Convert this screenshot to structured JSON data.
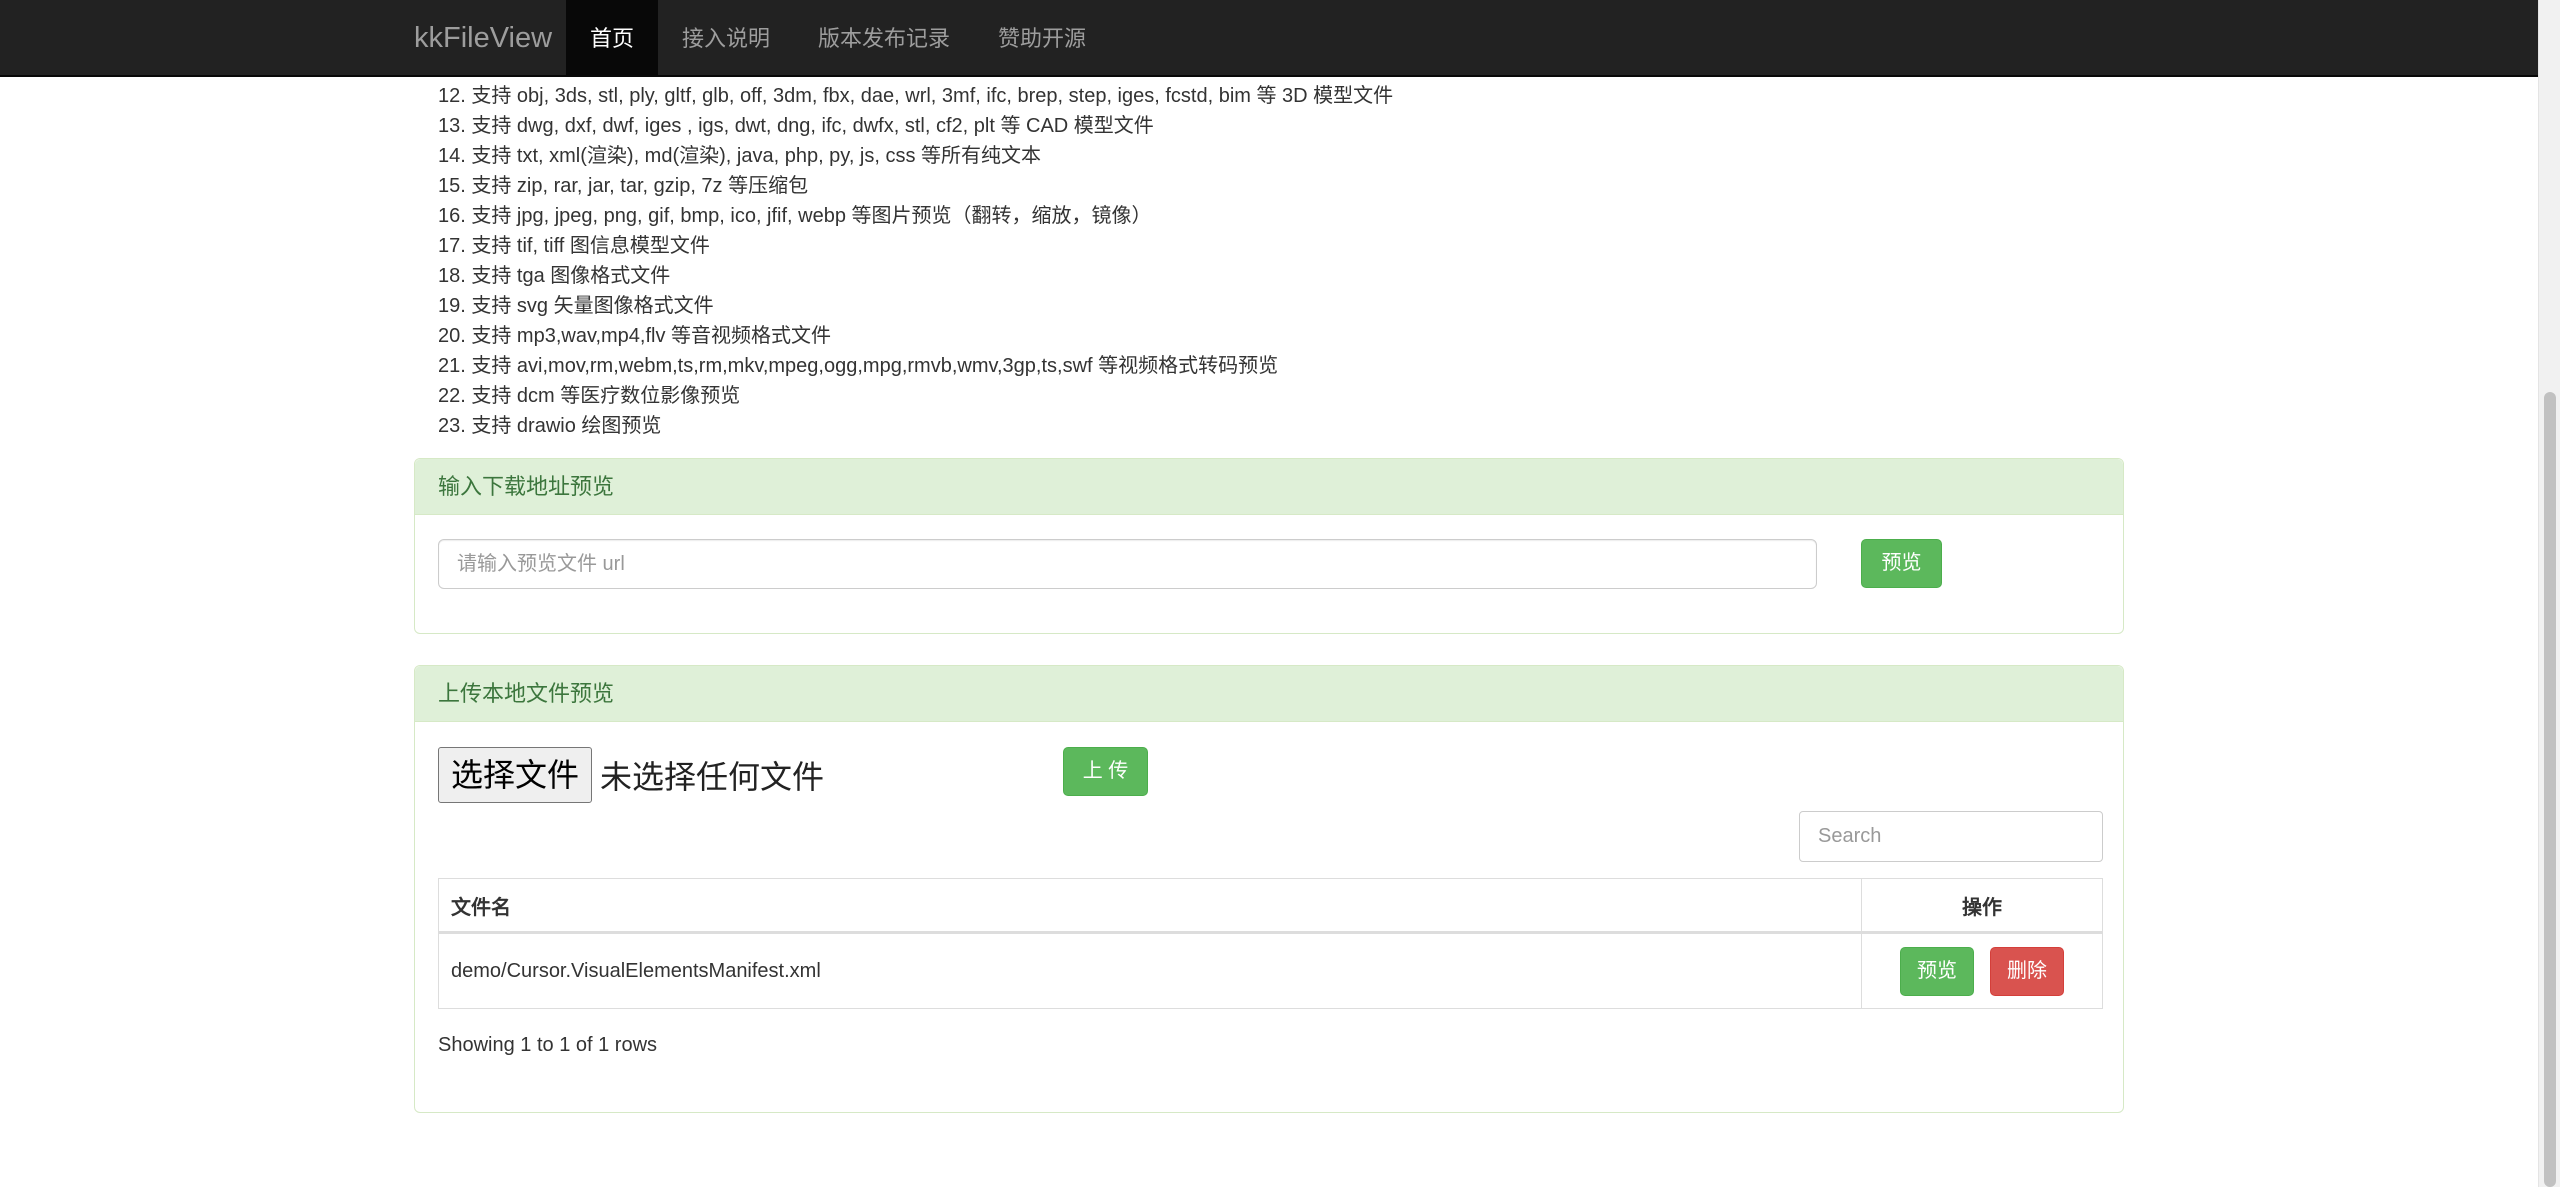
{
  "navbar": {
    "brand": "kkFileView",
    "items": [
      {
        "label": "首页",
        "active": true
      },
      {
        "label": "接入说明",
        "active": false
      },
      {
        "label": "版本发布记录",
        "active": false
      },
      {
        "label": "赞助开源",
        "active": false
      }
    ]
  },
  "features": [
    "12. 支持 obj, 3ds, stl, ply, gltf, glb, off, 3dm, fbx, dae, wrl, 3mf, ifc, brep, step, iges, fcstd, bim 等 3D 模型文件",
    "13. 支持 dwg, dxf, dwf, iges , igs, dwt, dng, ifc, dwfx, stl, cf2, plt 等 CAD 模型文件",
    "14. 支持 txt, xml(渲染), md(渲染), java, php, py, js, css 等所有纯文本",
    "15. 支持 zip, rar, jar, tar, gzip, 7z 等压缩包",
    "16. 支持 jpg, jpeg, png, gif, bmp, ico, jfif, webp 等图片预览（翻转，缩放，镜像）",
    "17. 支持 tif, tiff 图信息模型文件",
    "18. 支持 tga 图像格式文件",
    "19. 支持 svg 矢量图像格式文件",
    "20. 支持 mp3,wav,mp4,flv 等音视频格式文件",
    "21. 支持 avi,mov,rm,webm,ts,rm,mkv,mpeg,ogg,mpg,rmvb,wmv,3gp,ts,swf 等视频格式转码预览",
    "22. 支持 dcm 等医疗数位影像预览",
    "23. 支持 drawio 绘图预览"
  ],
  "url_panel": {
    "title": "输入下载地址预览",
    "input_value": "",
    "input_placeholder": "请输入预览文件 url",
    "preview_label": "预览"
  },
  "upload_panel": {
    "title": "上传本地文件预览",
    "choose_file_label": "选择文件",
    "file_status": "未选择任何文件",
    "upload_label": "上 传",
    "search_placeholder": "Search",
    "table": {
      "columns": [
        "文件名",
        "操作"
      ],
      "rows": [
        {
          "name": "demo/Cursor.VisualElementsManifest.xml",
          "preview_label": "预览",
          "delete_label": "删除"
        }
      ]
    },
    "pagination_info": "Showing 1 to 1 of 1 rows"
  },
  "colors": {
    "navbar_bg": "#222222",
    "panel_heading_bg": "#dff0d8",
    "panel_heading_text": "#3c763d",
    "success": "#5cb85c",
    "danger": "#d9534f"
  }
}
